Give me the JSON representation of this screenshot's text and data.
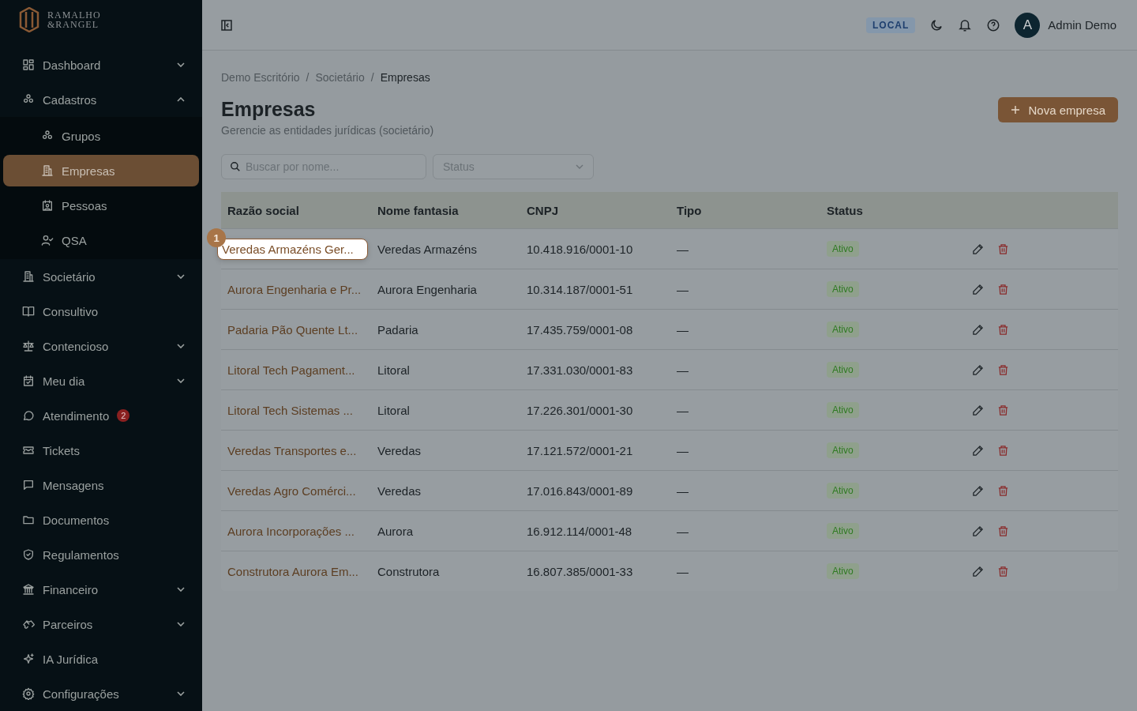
{
  "logo": {
    "line_1": "RAMALHO",
    "line_2": "&RANGEL"
  },
  "sidebar": {
    "items": [
      {
        "label": "Dashboard",
        "expandable": true,
        "expanded": false,
        "selected": false
      },
      {
        "label": "Cadastros",
        "expandable": true,
        "expanded": true,
        "selected": false,
        "children": [
          {
            "label": "Grupos",
            "selected": false
          },
          {
            "label": "Empresas",
            "selected": true
          },
          {
            "label": "Pessoas",
            "selected": false
          },
          {
            "label": "QSA",
            "selected": false
          }
        ]
      },
      {
        "label": "Societário",
        "expandable": true,
        "expanded": false,
        "selected": false
      },
      {
        "label": "Consultivo",
        "expandable": false,
        "selected": false
      },
      {
        "label": "Contencioso",
        "expandable": true,
        "expanded": false,
        "selected": false
      },
      {
        "label": "Meu dia",
        "expandable": true,
        "expanded": false,
        "selected": false
      },
      {
        "label": "Atendimento",
        "expandable": false,
        "selected": false,
        "badge": "2"
      },
      {
        "label": "Tickets",
        "expandable": false,
        "selected": false
      },
      {
        "label": "Mensagens",
        "expandable": false,
        "selected": false
      },
      {
        "label": "Documentos",
        "expandable": false,
        "selected": false
      },
      {
        "label": "Regulamentos",
        "expandable": false,
        "selected": false
      },
      {
        "label": "Financeiro",
        "expandable": true,
        "expanded": false,
        "selected": false
      },
      {
        "label": "Parceiros",
        "expandable": true,
        "expanded": false,
        "selected": false
      },
      {
        "label": "IA Jurídica",
        "expandable": false,
        "selected": false
      },
      {
        "label": "Configurações",
        "expandable": true,
        "expanded": false,
        "selected": false
      }
    ]
  },
  "header": {
    "environment": "LOCAL",
    "avatar": "A",
    "user": "Admin Demo"
  },
  "breadcrumb": [
    "Demo Escritório",
    "/",
    "Societário",
    "/",
    "Empresas"
  ],
  "page": {
    "title": "Empresas",
    "subtitle": "Gerencie as entidades jurídicas (societário)",
    "new_button": "Nova empresa"
  },
  "filters": {
    "search": {
      "placeholder": "Buscar por nome..."
    },
    "status": {
      "placeholder": "Status"
    }
  },
  "tour": {
    "step": "1"
  },
  "table": {
    "columns": [
      "Razão social",
      "Nome fantasia",
      "CNPJ",
      "Tipo",
      "Status"
    ],
    "rows": [
      {
        "razao_social": "Veredas Armazéns Ger...",
        "nome_fantasia": "Veredas Armazéns",
        "cnpj": "10.418.916/0001-10",
        "tipo": "—",
        "status": "Ativo",
        "highlighted": true
      },
      {
        "razao_social": "Aurora Engenharia e Pr...",
        "nome_fantasia": "Aurora Engenharia",
        "cnpj": "10.314.187/0001-51",
        "tipo": "—",
        "status": "Ativo",
        "highlighted": false
      },
      {
        "razao_social": "Padaria Pão Quente Lt...",
        "nome_fantasia": "Padaria",
        "cnpj": "17.435.759/0001-08",
        "tipo": "—",
        "status": "Ativo",
        "highlighted": false
      },
      {
        "razao_social": "Litoral Tech Pagament...",
        "nome_fantasia": "Litoral",
        "cnpj": "17.331.030/0001-83",
        "tipo": "—",
        "status": "Ativo",
        "highlighted": false
      },
      {
        "razao_social": "Litoral Tech Sistemas ...",
        "nome_fantasia": "Litoral",
        "cnpj": "17.226.301/0001-30",
        "tipo": "—",
        "status": "Ativo",
        "highlighted": false
      },
      {
        "razao_social": "Veredas Transportes e...",
        "nome_fantasia": "Veredas",
        "cnpj": "17.121.572/0001-21",
        "tipo": "—",
        "status": "Ativo",
        "highlighted": false
      },
      {
        "razao_social": "Veredas Agro Comérci...",
        "nome_fantasia": "Veredas",
        "cnpj": "17.016.843/0001-89",
        "tipo": "—",
        "status": "Ativo",
        "highlighted": false
      },
      {
        "razao_social": "Aurora Incorporações ...",
        "nome_fantasia": "Aurora",
        "cnpj": "16.912.114/0001-48",
        "tipo": "—",
        "status": "Ativo",
        "highlighted": false
      },
      {
        "razao_social": "Construtora Aurora Em...",
        "nome_fantasia": "Construtora",
        "cnpj": "16.807.385/0001-33",
        "tipo": "—",
        "status": "Ativo",
        "highlighted": false
      }
    ]
  }
}
